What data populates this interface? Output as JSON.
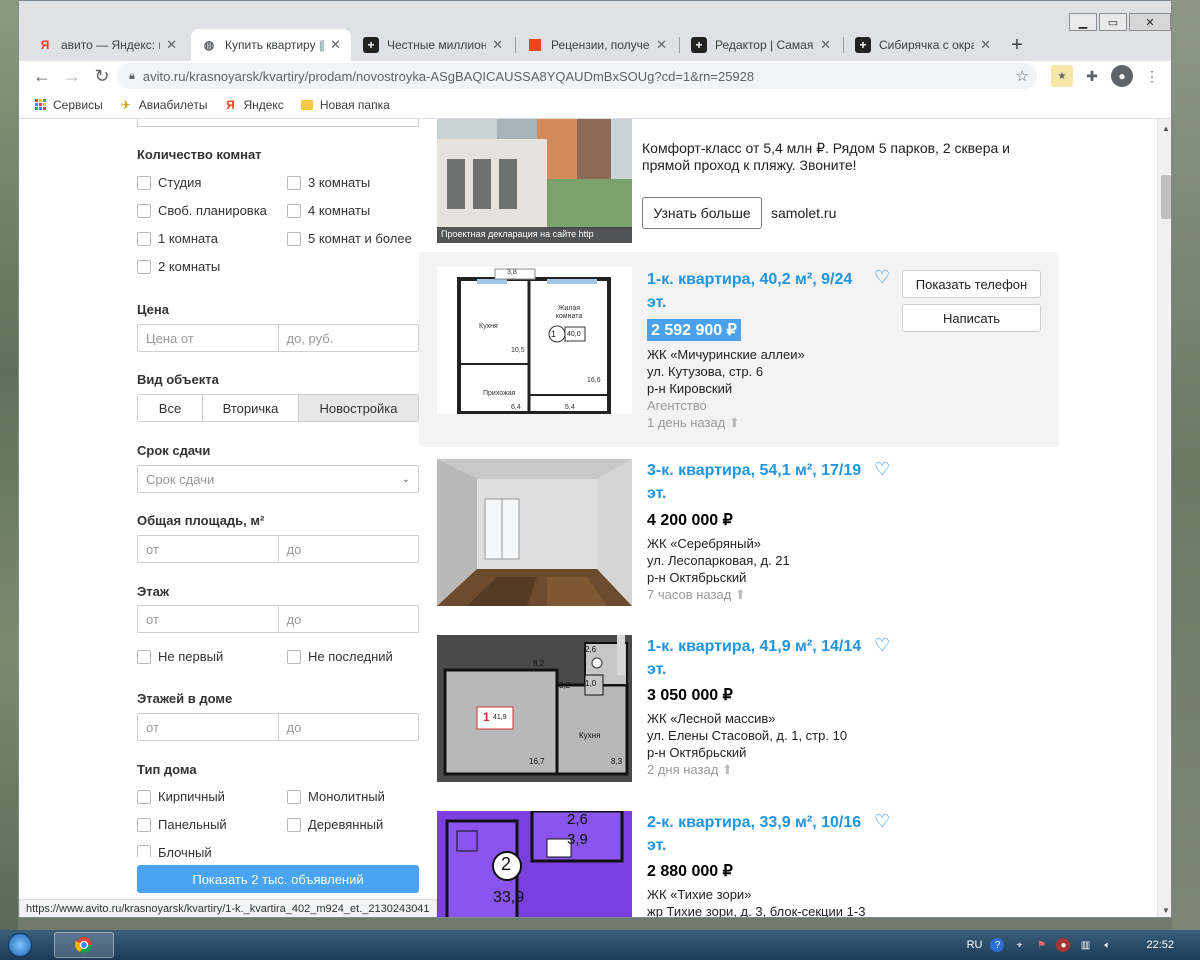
{
  "browser": {
    "tabs": [
      {
        "title": "авито — Яндекс: на",
        "icon": "yandex-icon",
        "icon_color": "#fc3f1d"
      },
      {
        "title": "Купить квартиру 🏢",
        "icon": "globe-icon",
        "icon_color": "#5f6368"
      },
      {
        "title": "Честные миллионы",
        "icon": "plus-square-icon",
        "icon_color": "#222222"
      },
      {
        "title": "Рецензии, получен",
        "icon": "red-square-icon",
        "icon_color": "#e8461b"
      },
      {
        "title": "Редактор | Самая гр",
        "icon": "plus-square-icon",
        "icon_color": "#222222"
      },
      {
        "title": "Сибирячка с окраи",
        "icon": "plus-square-icon",
        "icon_color": "#222222"
      }
    ],
    "url": "avito.ru/krasnoyarsk/kvartiry/prodam/novostroyka-ASgBAQICAUSSA8YQAUDmBxSOUg?cd=1&rn=25928",
    "bookmarks": [
      {
        "label": "Сервисы",
        "icon": "apps-grid-icon"
      },
      {
        "label": "Авиабилеты",
        "icon": "airplane-icon"
      },
      {
        "label": "Яндекс",
        "icon": "yandex-icon"
      },
      {
        "label": "Новая папка",
        "icon": "folder-icon"
      }
    ],
    "status_url": "https://www.avito.ru/krasnoyarsk/kvartiry/1-k._kvartira_402_m924_et._2130243041"
  },
  "filters": {
    "rooms": {
      "heading": "Количество комнат",
      "left": [
        "Студия",
        "Своб. планировка",
        "1 комната",
        "2 комнаты"
      ],
      "right": [
        "3 комнаты",
        "4 комнаты",
        "5 комнат и более"
      ]
    },
    "price": {
      "heading": "Цена",
      "from": "Цена от",
      "to": "до, руб."
    },
    "object_type": {
      "heading": "Вид объекта",
      "options": [
        "Все",
        "Вторичка",
        "Новостройка"
      ],
      "selected": "Новостройка"
    },
    "deadline": {
      "heading": "Срок сдачи",
      "placeholder": "Срок сдачи"
    },
    "area": {
      "heading": "Общая площадь, м²",
      "from": "от",
      "to": "до"
    },
    "floor": {
      "heading": "Этаж",
      "from": "от",
      "to": "до",
      "not_first": "Не первый",
      "not_last": "Не последний"
    },
    "floors_total": {
      "heading": "Этажей в доме",
      "from": "от",
      "to": "до"
    },
    "house_type": {
      "heading": "Тип дома",
      "left": [
        "Кирпичный",
        "Панельный",
        "Блочный"
      ],
      "right": [
        "Монолитный",
        "Деревянный"
      ]
    },
    "show_button": "Показать 2 тыс. объявлений"
  },
  "ad": {
    "text": "Комфорт-класс от 5,4 млн ₽. Рядом 5 парков, 2 сквера и прямой проход к пляжу. Звоните!",
    "button": "Узнать больше",
    "site": "samolet.ru",
    "image_caption": "Проектная декларация на сайте http"
  },
  "listings": [
    {
      "title": "1-к. квартира, 40,2 м², 9/24 эт.",
      "price": "2 592 900 ₽",
      "complex": "ЖК «Мичуринские аллеи»",
      "address": "ул. Кутузова, стр. 6",
      "district": "р-н Кировский",
      "seller": "Агентство",
      "time": "1 день назад",
      "phone_button": "Показать телефон",
      "write_button": "Написать",
      "plan": {
        "kitchen": "Кухня",
        "living": "Жилая комната",
        "hall": "Прихожая",
        "n1": "3,8",
        "n2": "10,5",
        "n3": "16,6",
        "n4": "6,4",
        "n5": "5,4",
        "badge": "1",
        "badge_area": "40,0"
      }
    },
    {
      "title": "3-к. квартира, 54,1 м², 17/19 эт.",
      "price": "4 200 000 ₽",
      "complex": "ЖК «Серебряный»",
      "address": "ул. Лесопарковая, д. 21",
      "district": "р-н Октябрьский",
      "time": "7 часов назад"
    },
    {
      "title": "1-к. квартира, 41,9 м², 14/14 эт.",
      "price": "3 050 000 ₽",
      "complex": "ЖК «Лесной массив»",
      "address": "ул. Елены Стасовой, д. 1, стр. 10",
      "district": "р-н Октябрьский",
      "time": "2 дня назад",
      "plan": {
        "kitchen": "Кухня",
        "n1": "2,6",
        "n2": "8,2",
        "n3": "3,2",
        "n4": "1,0",
        "n5": "16,7",
        "n6": "8,3",
        "badge": "1",
        "badge_area": "41,9"
      }
    },
    {
      "title": "2-к. квартира, 33,9 м², 10/16 эт.",
      "price": "2 880 000 ₽",
      "complex": "ЖК «Тихие зори»",
      "address": "жр Тихие зори, д. 3, блок-секции 1-3",
      "plan": {
        "n1": "2,6",
        "n2": "3,9",
        "badge": "2",
        "badge_area": "33,9"
      }
    }
  ],
  "taskbar": {
    "lang": "RU",
    "time": "22:52"
  }
}
